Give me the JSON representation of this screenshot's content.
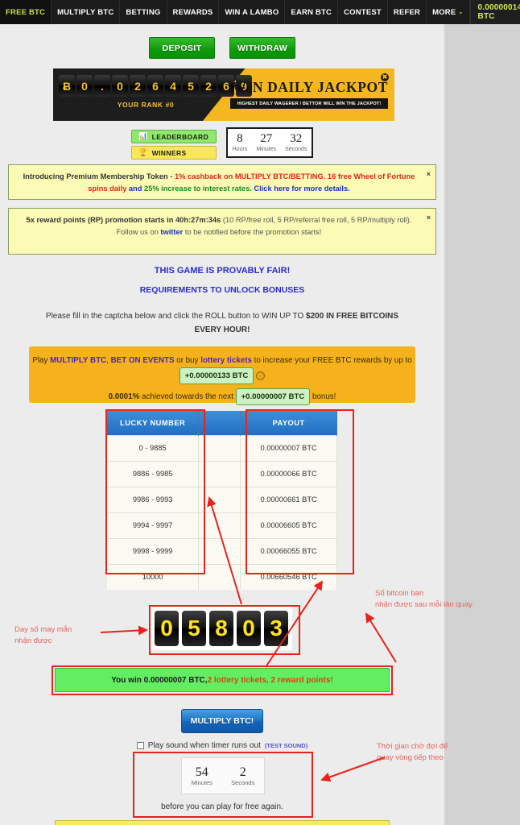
{
  "navbar": {
    "items": [
      {
        "label": "FREE BTC",
        "active": true
      },
      {
        "label": "MULTIPLY BTC",
        "active": false
      },
      {
        "label": "BETTING",
        "active": false
      },
      {
        "label": "REWARDS",
        "active": false
      },
      {
        "label": "WIN A LAMBO",
        "active": false
      },
      {
        "label": "EARN BTC",
        "active": false
      },
      {
        "label": "CONTEST",
        "active": false
      },
      {
        "label": "REFER",
        "active": false
      },
      {
        "label": "MORE",
        "active": false,
        "chevron": "⌄"
      }
    ],
    "balance": "0.00000014 BTC",
    "power_icon": "⏻"
  },
  "actions": {
    "deposit": "DEPOSIT",
    "withdraw": "WITHDRAW"
  },
  "jackpot": {
    "digits": [
      "Ƀ",
      "0",
      ".",
      "0",
      "2",
      "6",
      "4",
      "5",
      "2",
      "6",
      "9"
    ],
    "rank": "YOUR RANK #0",
    "title": "WIN DAILY JACKPOT",
    "subtitle": "HIGHEST DAILY WAGERER / BETTOR WILL WIN THE JACKPOT!",
    "close_icon": "✖"
  },
  "leaderboard": {
    "leaderboard_label": "LEADERBOARD",
    "leaderboard_icon": "📊",
    "winners_label": "WINNERS",
    "winners_icon": "🏆",
    "timer": [
      {
        "value": "8",
        "label": "Hours"
      },
      {
        "value": "27",
        "label": "Minutes"
      },
      {
        "value": "32",
        "label": "Seconds"
      }
    ]
  },
  "notice1": {
    "close": "×",
    "p1": "Introducing Premium Membership Token - ",
    "p2": "1% cashback on MULTIPLY BTC/BETTING. 16 free Wheel of Fortune spins daily",
    "p3": " and ",
    "p4": "25% increase to interest rates.",
    "p5": " Click here for more details."
  },
  "notice2": {
    "close": "×",
    "p1": "5x reward points (RP) promotion starts in 40h:27m:34s",
    "p2": " (10 RP/free roll, 5 RP/referral free roll, 5 RP/multiply roll).",
    "p3": "Follow us on ",
    "p4": "twitter",
    "p5": " to be notified before the promotion starts!"
  },
  "headings": {
    "provably_fair": "THIS GAME IS PROVABLY FAIR!",
    "requirements": "REQUIREMENTS TO UNLOCK BONUSES",
    "captcha_p1": "Please fill in the captcha below and click the ROLL button to WIN UP TO ",
    "captcha_p2": "$200 IN FREE BITCOINS EVERY HOUR!"
  },
  "orange_box": {
    "p1": "Play ",
    "link1": "MULTIPLY BTC",
    "p2": ", ",
    "link2": "BET ON EVENTS",
    "p3": " or buy ",
    "link3": "lottery tickets",
    "p4": " to increase your FREE BTC rewards by up to ",
    "pill1": "+0.00000133 BTC",
    "info_icon": "ⓘ",
    "p5": "0.0001%",
    "p6": " achieved towards the next ",
    "pill2": "+0.00000007 BTC",
    "p7": " bonus!"
  },
  "table": {
    "headers": [
      "LUCKY NUMBER",
      "",
      "PAYOUT"
    ],
    "rows": [
      {
        "lucky": "0 - 9885",
        "mid": "",
        "payout": "0.00000007 BTC"
      },
      {
        "lucky": "9886 - 9985",
        "mid": "",
        "payout": "0.00000066 BTC"
      },
      {
        "lucky": "9986 - 9993",
        "mid": "",
        "payout": "0.00000661 BTC"
      },
      {
        "lucky": "9994 - 9997",
        "mid": "",
        "payout": "0.00006605 BTC"
      },
      {
        "lucky": "9998 - 9999",
        "mid": "",
        "payout": "0.00066055 BTC"
      },
      {
        "lucky": "10000",
        "mid": "",
        "payout": "0.00660546 BTC"
      }
    ]
  },
  "roll_result": {
    "digits": [
      "0",
      "5",
      "8",
      "0",
      "3"
    ]
  },
  "win_message": {
    "p1": "You win 0.00000007 BTC, ",
    "p2": "2 lottery tickets, 2 reward points!"
  },
  "multiply_button": "MULTIPLY BTC!",
  "sound_row": {
    "label": "Play sound when timer runs out",
    "test": "(TEST SOUND)"
  },
  "countdown": {
    "cells": [
      {
        "value": "54",
        "label": "Minutes"
      },
      {
        "value": "2",
        "label": "Seconds"
      }
    ],
    "text": "before you can play for free again."
  },
  "annotations": {
    "lucky_number": "Day số may mắn\nnhận được",
    "lucky_number_l1": "Day số may mắn",
    "lucky_number_l2": "nhận được",
    "bitcoin_l1": "Số bitcoin bạn",
    "bitcoin_l2": "nhận được sau mỗi lần quay",
    "wait_l1": "Thời gian chờ đợi để",
    "wait_l2": "quay vòng tiếp theo"
  },
  "colors": {
    "accent_yellow": "#f5b721",
    "nav_bg": "#1b1b1b",
    "annotation_red": "#e8231b",
    "win_green": "#63ed63",
    "link_blue": "#2b2bd4"
  }
}
